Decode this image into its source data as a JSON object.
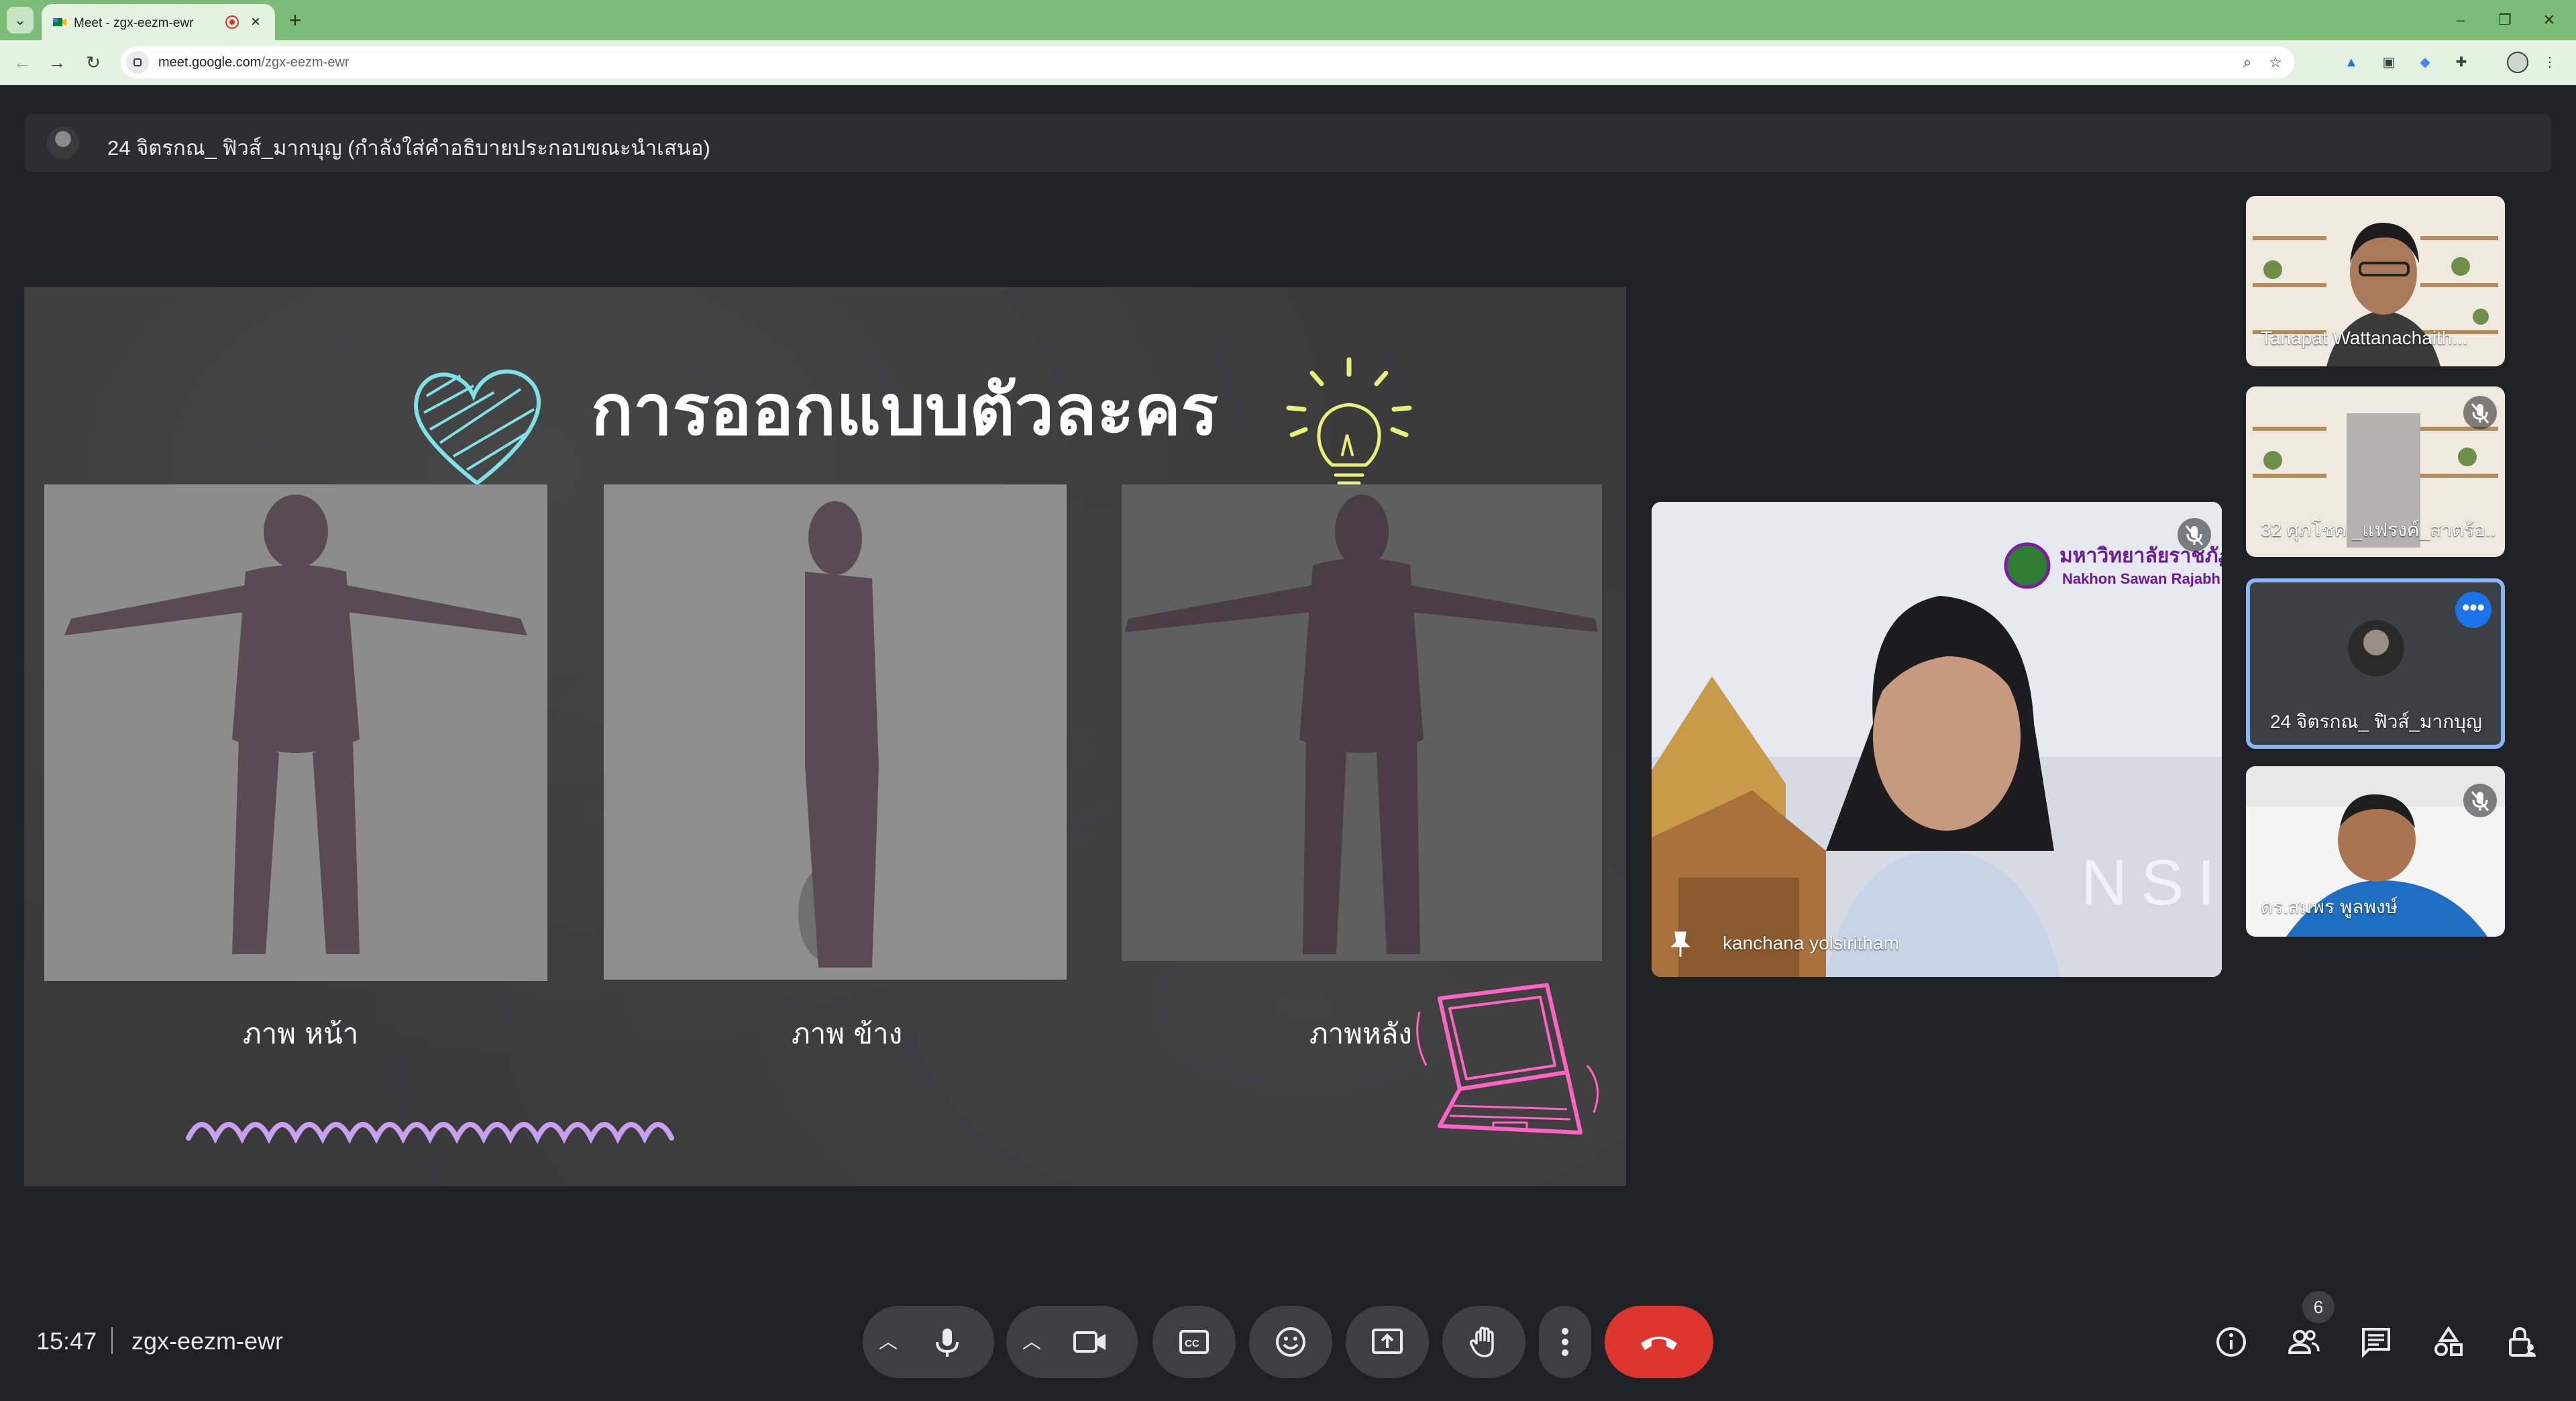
{
  "browser": {
    "tab_title": "Meet - zgx-eezm-ewr",
    "url_domain": "meet.google.com",
    "url_path": "/zgx-eezm-ewr"
  },
  "meet": {
    "presenter_banner": "24 จิตรกณ_ ฟิวส์_มากบุญ (กำลังใส่คำอธิบายประกอบขณะนำเสนอ)",
    "slide": {
      "title": "การออกแบบตัวละคร",
      "captions": [
        "ภาพ หน้า",
        "ภาพ ข้าง",
        "ภาพหลัง"
      ]
    },
    "pinned": {
      "name": "kanchana yolsiritham",
      "logo_line1": "มหาวิทยาลัยราชภัฏ",
      "logo_line2": "Nakhon Sawan Rajabh",
      "bg_text": "NSI"
    },
    "participants": [
      {
        "name": "Tanapat Wattanachaith...",
        "muted": false
      },
      {
        "name": "32 ศุภโชค _แฟรงค์_สาตร้อ...",
        "muted": true
      },
      {
        "name": "24 จิตรกณ_ ฟิวส์_มากบุญ",
        "muted": false
      },
      {
        "name": "ดร.สมพร พูลพงษ์",
        "muted": true
      }
    ],
    "time": "15:47",
    "meeting_code": "zgx-eezm-ewr",
    "people_count": "6"
  },
  "colors": {
    "tabstrip": "#7dbb78",
    "toolbar": "#e4f2e2",
    "meet_bg": "#202124",
    "control": "#3c4043",
    "end_call": "#dc362e",
    "active_border": "#8ab4f8",
    "accent_blue": "#1a73e8",
    "heart": "#7fe0e6",
    "bulb": "#e9f07a",
    "laptop": "#ff63c6",
    "squiggle": "#c9a0f0"
  }
}
